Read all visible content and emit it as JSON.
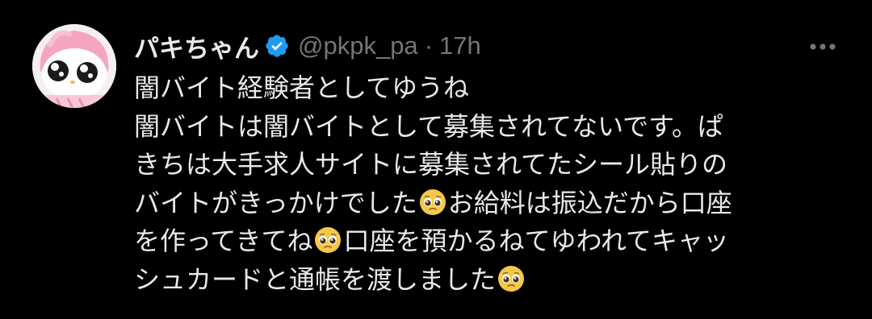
{
  "tweet": {
    "display_name": "パキちゃん",
    "handle": "@pkpk_pa",
    "separator": "·",
    "time": "17h",
    "lines": [
      {
        "text": "闇バイト経験者としてゆうね"
      },
      {
        "text": "闇バイトは闇バイトとして募集されてないです。ぱ"
      },
      {
        "text": "きちは大手求人サイトに募集されてたシール貼りの"
      },
      {
        "text": "バイトがきっかけでした",
        "emoji": "pleading-face-emoji",
        "text_after": "お給料は振込だから口座"
      },
      {
        "text": "を作ってきてね",
        "emoji": "pleading-face-emoji",
        "text_after": "口座を預かるねてゆわれてキャッ"
      },
      {
        "text": "シュカードと通帳を渡しました",
        "emoji": "pleading-face-emoji",
        "text_after": ""
      }
    ]
  },
  "colors": {
    "background": "#000000",
    "primary_text": "#e7e9ea",
    "secondary_text": "#71767b",
    "verified_blue": "#1d9bf0"
  },
  "icons": {
    "verified": "verified-badge-icon",
    "more": "more-options-icon",
    "emoji": "pleading-face-emoji"
  }
}
